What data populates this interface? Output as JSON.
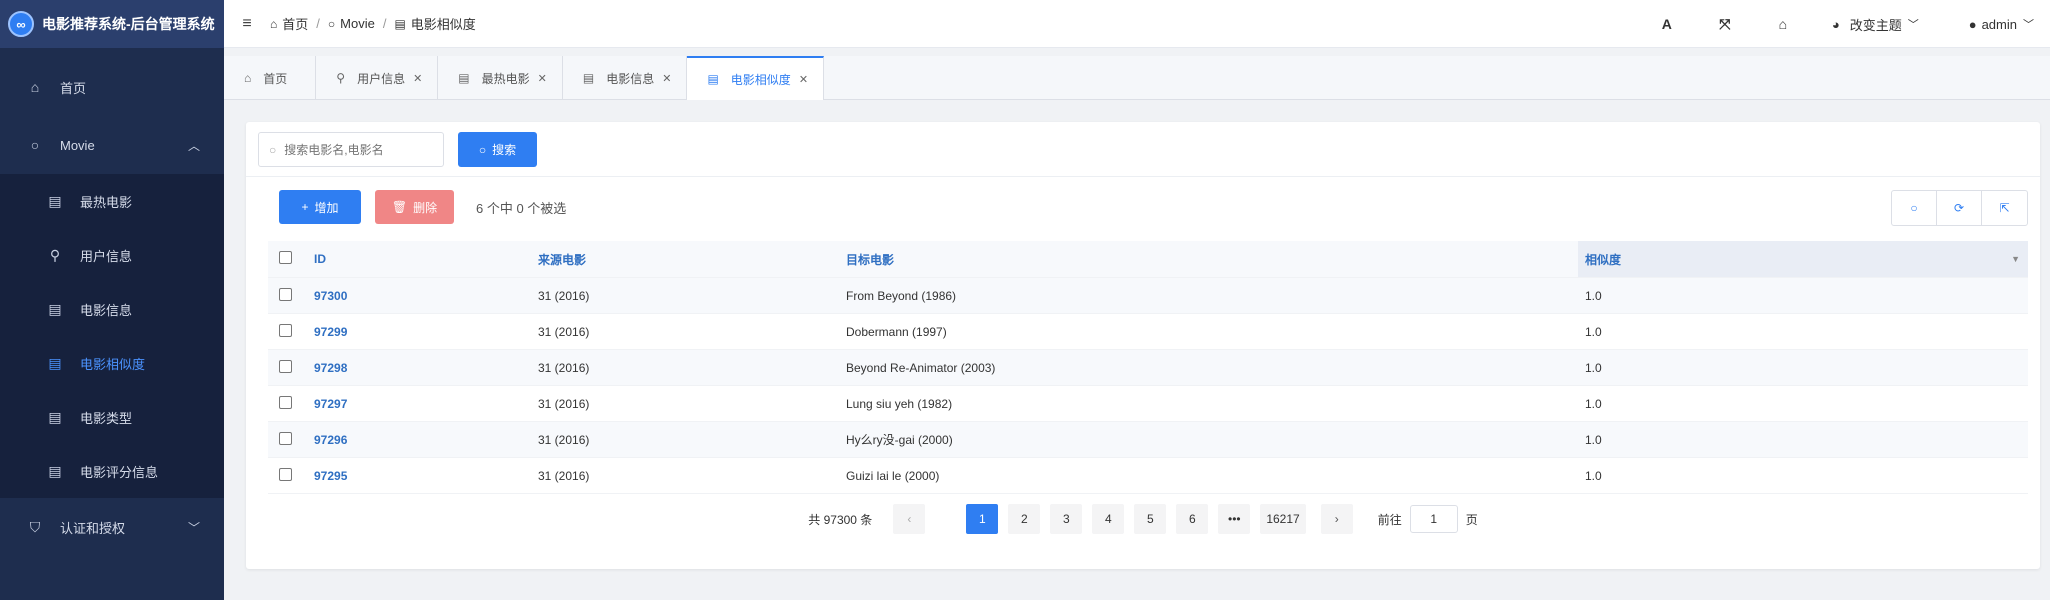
{
  "app": {
    "logo_glyph": "∞",
    "title": "电影推荐系统-后台管理系统"
  },
  "sidebar": {
    "home": {
      "icon": "home-icon",
      "label": "首页"
    },
    "movie_group": {
      "icon": "circle-icon",
      "label": "Movie",
      "expanded": true
    },
    "items": [
      {
        "icon": "film-icon",
        "label": "最热电影",
        "active": false
      },
      {
        "icon": "user-icon",
        "label": "用户信息",
        "active": false
      },
      {
        "icon": "film-icon",
        "label": "电影信息",
        "active": false
      },
      {
        "icon": "film-icon",
        "label": "电影相似度",
        "active": true
      },
      {
        "icon": "film-icon",
        "label": "电影类型",
        "active": false
      },
      {
        "icon": "film-icon",
        "label": "电影评分信息",
        "active": false
      }
    ],
    "auth_group": {
      "icon": "shield-icon",
      "label": "认证和授权",
      "expanded": false
    }
  },
  "header": {
    "breadcrumb": [
      {
        "icon": "home-icon",
        "label": "首页"
      },
      {
        "icon": "circle-icon",
        "label": "Movie"
      },
      {
        "icon": "film-icon",
        "label": "电影相似度"
      }
    ],
    "font_btn": "A",
    "theme_label": "改变主题",
    "user_label": "admin"
  },
  "tabs": [
    {
      "icon": "home-icon",
      "label": "首页",
      "closable": false,
      "active": false
    },
    {
      "icon": "user-icon",
      "label": "用户信息",
      "closable": true,
      "active": false
    },
    {
      "icon": "film-icon",
      "label": "最热电影",
      "closable": true,
      "active": false
    },
    {
      "icon": "film-icon",
      "label": "电影信息",
      "closable": true,
      "active": false
    },
    {
      "icon": "film-icon",
      "label": "电影相似度",
      "closable": true,
      "active": true
    }
  ],
  "search": {
    "placeholder": "搜索电影名,电影名",
    "value": "",
    "button_label": "搜索"
  },
  "toolbar": {
    "add_label": "增加",
    "delete_label": "删除",
    "selection_info": "6 个中 0 个被选"
  },
  "table": {
    "headers": {
      "id": "ID",
      "source": "来源电影",
      "target": "目标电影",
      "similarity": "相似度"
    },
    "rows": [
      {
        "id": "97300",
        "source": "31 (2016)",
        "target": "From Beyond (1986)",
        "similarity": "1.0"
      },
      {
        "id": "97299",
        "source": "31 (2016)",
        "target": "Dobermann (1997)",
        "similarity": "1.0"
      },
      {
        "id": "97298",
        "source": "31 (2016)",
        "target": "Beyond Re-Animator (2003)",
        "similarity": "1.0"
      },
      {
        "id": "97297",
        "source": "31 (2016)",
        "target": "Lung siu yeh (1982)",
        "similarity": "1.0"
      },
      {
        "id": "97296",
        "source": "31 (2016)",
        "target": "Hy么ry没-gai (2000)",
        "similarity": "1.0"
      },
      {
        "id": "97295",
        "source": "31 (2016)",
        "target": "Guizi lai le (2000)",
        "similarity": "1.0"
      }
    ]
  },
  "pagination": {
    "total_text": "共 97300 条",
    "pages": [
      "1",
      "2",
      "3",
      "4",
      "5",
      "6"
    ],
    "ellipsis": "•••",
    "last_page": "16217",
    "current": "1",
    "goto_prefix": "前往",
    "goto_value": "1",
    "goto_suffix": "页"
  }
}
